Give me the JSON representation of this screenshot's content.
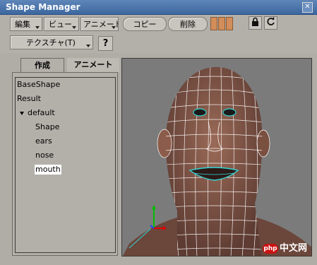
{
  "window": {
    "title": "Shape Manager"
  },
  "toolbar": {
    "row1": [
      "編集",
      "ビュー",
      "アニメート",
      "コピー",
      "削除"
    ],
    "row2_texture": "テクスチャ(T)",
    "help": "?"
  },
  "tabs": [
    "作成",
    "アニメート"
  ],
  "tree": {
    "items": [
      "BaseShape",
      "Result",
      "default",
      "Shape",
      "ears",
      "nose",
      "mouth"
    ],
    "selected": "mouth"
  },
  "watermark": {
    "logo": "php",
    "text": "中文网"
  },
  "colors": {
    "title_bar": "#3c679f",
    "panel_bg": "#b3b0aa",
    "wire": "#ffffff",
    "skin": "#8a5a4a",
    "mouth_sel": "#33d6d6"
  }
}
